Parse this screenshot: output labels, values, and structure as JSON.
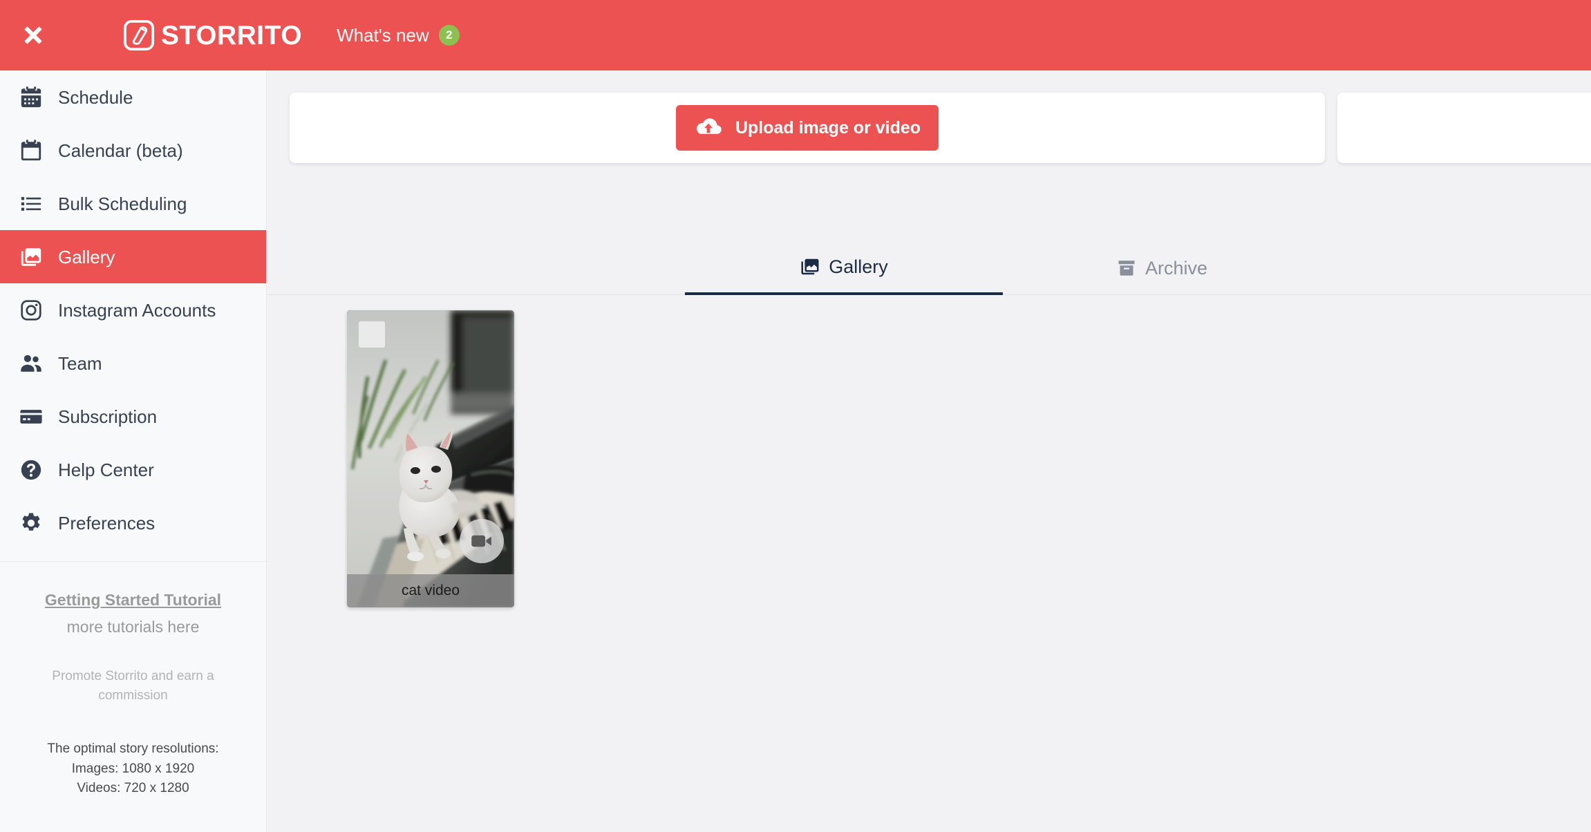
{
  "header": {
    "close_icon": "close-icon",
    "logo_icon": "storrito-logo-icon",
    "brand": "STORRITO",
    "whats_new": "What's new",
    "whats_new_count": "2",
    "bg_color": "#ec5252",
    "badge_color": "#8cc152"
  },
  "sidebar": {
    "items": [
      {
        "label": "Schedule",
        "icon": "calendar-days-icon",
        "active": false
      },
      {
        "label": "Calendar (beta)",
        "icon": "calendar-icon",
        "active": false
      },
      {
        "label": "Bulk Scheduling",
        "icon": "list-icon",
        "active": false
      },
      {
        "label": "Gallery",
        "icon": "images-icon",
        "active": true
      },
      {
        "label": "Instagram Accounts",
        "icon": "instagram-icon",
        "active": false
      },
      {
        "label": "Team",
        "icon": "users-icon",
        "active": false
      },
      {
        "label": "Subscription",
        "icon": "credit-card-icon",
        "active": false
      },
      {
        "label": "Help Center",
        "icon": "question-circle-icon",
        "active": false
      },
      {
        "label": "Preferences",
        "icon": "gear-icon",
        "active": false
      }
    ],
    "footer": {
      "tutorial_link": "Getting Started Tutorial",
      "tutorial_sub": "more tutorials here",
      "promo": "Promote Storrito and earn a commission",
      "resolutions_title": "The optimal story resolutions:",
      "resolutions_images": "Images: 1080 x 1920",
      "resolutions_videos": "Videos: 720 x 1280"
    }
  },
  "main": {
    "upload_button": "Upload image or video",
    "upload_icon": "cloud-upload-icon",
    "tabs": [
      {
        "label": "Gallery",
        "icon": "images-icon",
        "active": true
      },
      {
        "label": "Archive",
        "icon": "archive-box-icon",
        "active": false
      }
    ],
    "gallery_items": [
      {
        "caption": "cat video",
        "type": "video",
        "badge_icon": "video-camera-icon",
        "selected": false
      }
    ]
  }
}
